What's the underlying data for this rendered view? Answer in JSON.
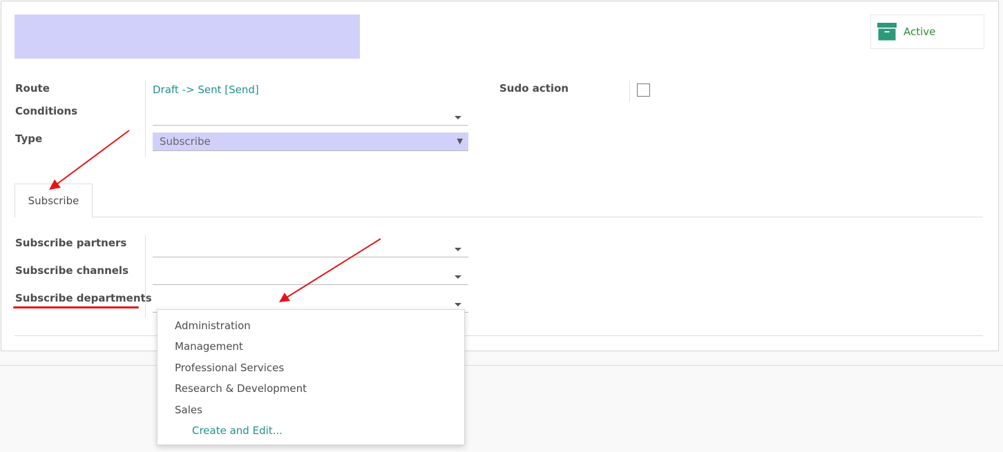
{
  "header": {
    "active_label": "Active",
    "active_icon": "archive-box-icon",
    "accent": "#2e8c2e"
  },
  "form": {
    "route_label": "Route",
    "route_value": "Draft -> Sent [Send]",
    "conditions_label": "Conditions",
    "conditions_value": "",
    "type_label": "Type",
    "type_value": "Subscribe",
    "sudo_label": "Sudo action",
    "sudo_checked": false
  },
  "tabs": [
    {
      "label": "Subscribe",
      "active": true
    }
  ],
  "subscribe": {
    "partners_label": "Subscribe partners",
    "partners_value": "",
    "channels_label": "Subscribe channels",
    "channels_value": "",
    "departments_label": "Subscribe departments",
    "departments_value": ""
  },
  "dropdown": {
    "options": [
      "Administration",
      "Management",
      "Professional Services",
      "Research & Development",
      "Sales"
    ],
    "create_label": "Create and Edit..."
  },
  "colors": {
    "highlight": "#d0d0fb",
    "link": "#21918c",
    "annotation": "#e8131a"
  }
}
